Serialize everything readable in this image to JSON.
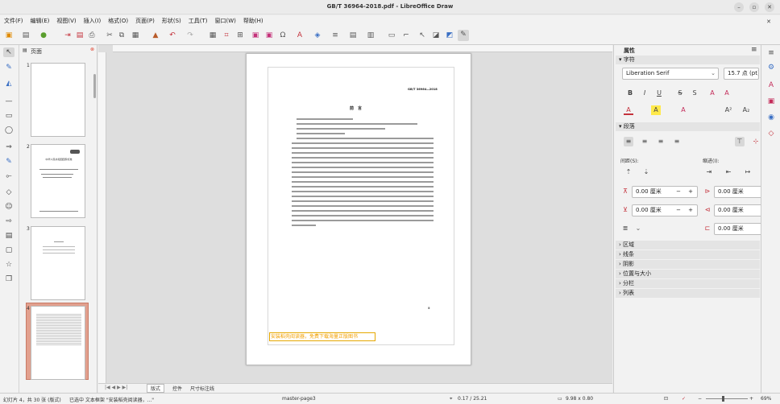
{
  "window": {
    "title": "GB/T 36964-2018.pdf - LibreOffice Draw"
  },
  "menu": [
    "文件(F)",
    "编辑(E)",
    "视图(V)",
    "插入(I)",
    "格式(O)",
    "页面(P)",
    "形状(S)",
    "工具(T)",
    "窗口(W)",
    "帮助(H)"
  ],
  "pages_panel": {
    "title": "页面",
    "pages": [
      "1",
      "2",
      "3",
      "4"
    ],
    "selected": "4",
    "thumb2_title": "中华人民共和国国家标准"
  },
  "document": {
    "header": "GB/T 36964—2018",
    "heading": "前　言",
    "page_number": "Ⅲ",
    "overlay_text": "安装稻壳阅读器，免费下载海量正版图书"
  },
  "tabs": [
    "版式",
    "控件",
    "尺寸标注线"
  ],
  "sidebar": {
    "title": "属性",
    "char_section": "字符",
    "font_name": "Liberation Serif",
    "font_size": "15.7 点 (pt)",
    "para_section": "段落",
    "spacing_label": "间距(S):",
    "indent_label": "缩进(I):",
    "spacing_above": "0.00 厘米",
    "spacing_below": "0.00 厘米",
    "indent_before": "0.00 厘米",
    "indent_after": "0.00 厘米",
    "indent_first": "0.00 厘米",
    "collapsed_sections": [
      "区域",
      "线条",
      "阴影",
      "位置与大小",
      "分栏",
      "列表"
    ]
  },
  "status": {
    "slide": "幻灯片 4，共 30 张 (版式)",
    "selection": "已选中 文本框架 \"安装稻壳阅读器，...\"",
    "master": "master-page3",
    "position": "0.17 / 25.21",
    "size": "9.98 x 0.80",
    "zoom": "69%"
  }
}
